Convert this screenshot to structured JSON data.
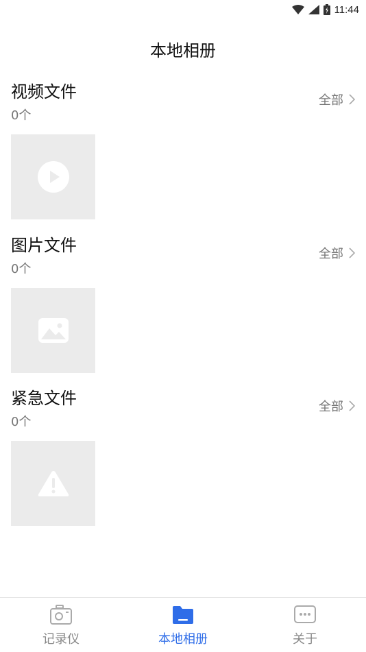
{
  "status_bar": {
    "time": "11:44"
  },
  "header": {
    "title": "本地相册"
  },
  "sections": [
    {
      "title": "视频文件",
      "count": "0个",
      "view_all": "全部",
      "thumb_icon": "play-icon"
    },
    {
      "title": "图片文件",
      "count": "0个",
      "view_all": "全部",
      "thumb_icon": "image-icon"
    },
    {
      "title": "紧急文件",
      "count": "0个",
      "view_all": "全部",
      "thumb_icon": "warning-icon"
    }
  ],
  "tabs": [
    {
      "label": "记录仪",
      "icon": "camera-icon",
      "active": false
    },
    {
      "label": "本地相册",
      "icon": "folder-icon",
      "active": true
    },
    {
      "label": "关于",
      "icon": "chat-icon",
      "active": false
    }
  ],
  "colors": {
    "accent": "#2f6de8",
    "muted": "#888888",
    "thumb_bg": "#ebebeb"
  }
}
